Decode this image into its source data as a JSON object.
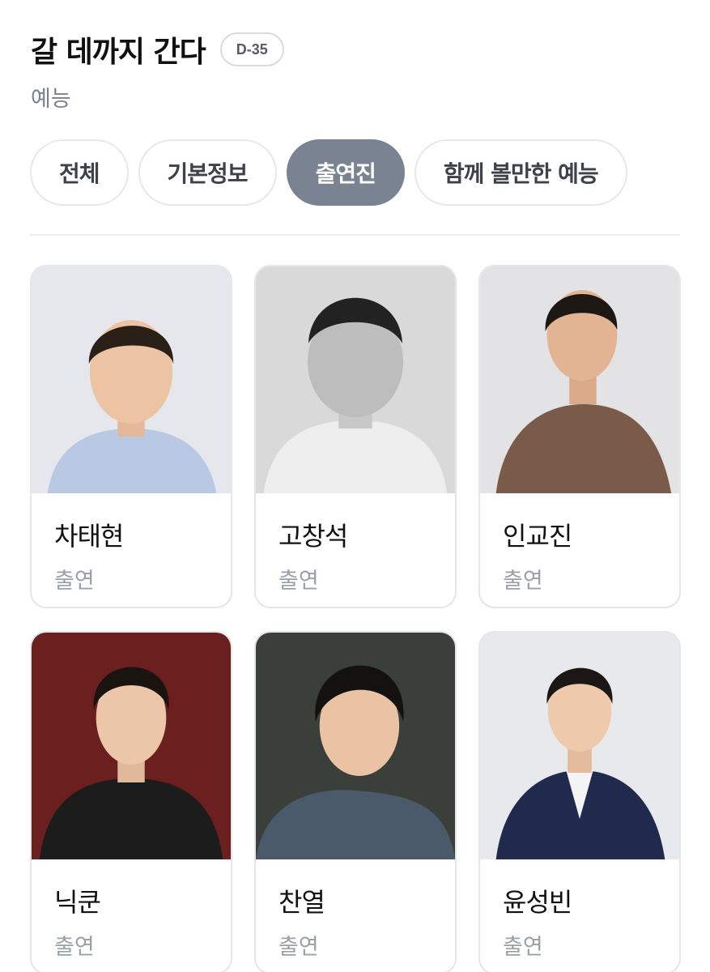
{
  "show": {
    "title": "갈 데까지 간다",
    "dday": "D-35",
    "genre": "예능"
  },
  "tabs": [
    {
      "label": "전체",
      "active": false
    },
    {
      "label": "기본정보",
      "active": false
    },
    {
      "label": "출연진",
      "active": true
    },
    {
      "label": "함께 볼만한 예능",
      "active": false
    }
  ],
  "cast": [
    {
      "name": "차태현",
      "role": "출연",
      "photo_bg": "#e6e7ec",
      "outfit": "#b9c9e3"
    },
    {
      "name": "고창석",
      "role": "출연",
      "photo_bg": "#d9d9d9",
      "outfit": "#eeeeee"
    },
    {
      "name": "인교진",
      "role": "출연",
      "photo_bg": "#e3e3e5",
      "outfit": "#7a5a48"
    },
    {
      "name": "닉쿤",
      "role": "출연",
      "photo_bg": "#6b1f1f",
      "outfit": "#1c1c1c"
    },
    {
      "name": "찬열",
      "role": "출연",
      "photo_bg": "#3a3f3a",
      "outfit": "#4a5a6a"
    },
    {
      "name": "윤성빈",
      "role": "출연",
      "photo_bg": "#e8e9ec",
      "outfit": "#1f2a4d"
    }
  ]
}
